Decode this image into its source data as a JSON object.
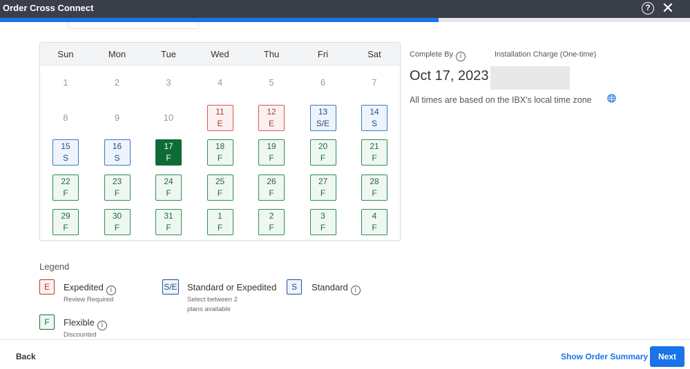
{
  "window": {
    "title": "Order Cross Connect",
    "help_icon": "?",
    "close_icon": "✕"
  },
  "progress": {
    "fraction": 0.636
  },
  "calendar": {
    "days_of_week": [
      "Sun",
      "Mon",
      "Tue",
      "Wed",
      "Thu",
      "Fri",
      "Sat"
    ],
    "weeks": [
      [
        {
          "n": "1"
        },
        {
          "n": "2"
        },
        {
          "n": "3"
        },
        {
          "n": "4"
        },
        {
          "n": "5"
        },
        {
          "n": "6"
        },
        {
          "n": "7"
        }
      ],
      [
        {
          "n": "8"
        },
        {
          "n": "9"
        },
        {
          "n": "10"
        },
        {
          "n": "11",
          "code": "E"
        },
        {
          "n": "12",
          "code": "E"
        },
        {
          "n": "13",
          "code": "S/E"
        },
        {
          "n": "14",
          "code": "S"
        }
      ],
      [
        {
          "n": "15",
          "code": "S"
        },
        {
          "n": "16",
          "code": "S"
        },
        {
          "n": "17",
          "code": "F",
          "selected": true
        },
        {
          "n": "18",
          "code": "F"
        },
        {
          "n": "19",
          "code": "F"
        },
        {
          "n": "20",
          "code": "F"
        },
        {
          "n": "21",
          "code": "F"
        }
      ],
      [
        {
          "n": "22",
          "code": "F"
        },
        {
          "n": "23",
          "code": "F"
        },
        {
          "n": "24",
          "code": "F"
        },
        {
          "n": "25",
          "code": "F"
        },
        {
          "n": "26",
          "code": "F"
        },
        {
          "n": "27",
          "code": "F"
        },
        {
          "n": "28",
          "code": "F"
        }
      ],
      [
        {
          "n": "29",
          "code": "F"
        },
        {
          "n": "30",
          "code": "F"
        },
        {
          "n": "31",
          "code": "F"
        },
        {
          "n": "1",
          "code": "F"
        },
        {
          "n": "2",
          "code": "F"
        },
        {
          "n": "3",
          "code": "F"
        },
        {
          "n": "4",
          "code": "F"
        }
      ]
    ]
  },
  "summary": {
    "complete_by_label": "Complete By",
    "installation_charge_label": "Installation Charge (One-time)",
    "complete_by_date": "Oct 17, 2023",
    "timezone_note": "All times are based on the IBX's local time zone"
  },
  "legend": {
    "title": "Legend",
    "items": [
      {
        "code": "E",
        "label": "Expedited",
        "sub": "Review Required"
      },
      {
        "code": "S/E",
        "label": "Standard or Expedited",
        "sub": "Select between 2 plans available"
      },
      {
        "code": "S",
        "label": "Standard",
        "sub": ""
      },
      {
        "code": "F",
        "label": "Flexible",
        "sub": "Discounted"
      }
    ]
  },
  "colors": {
    "accent": "#1a73e8",
    "expedited": "#d9534f",
    "standard": "#3a78c4",
    "flexible": "#2e8a57",
    "selected": "#0e6b38"
  },
  "footer": {
    "back": "Back",
    "show_summary": "Show Order Summary",
    "next": "Next"
  }
}
